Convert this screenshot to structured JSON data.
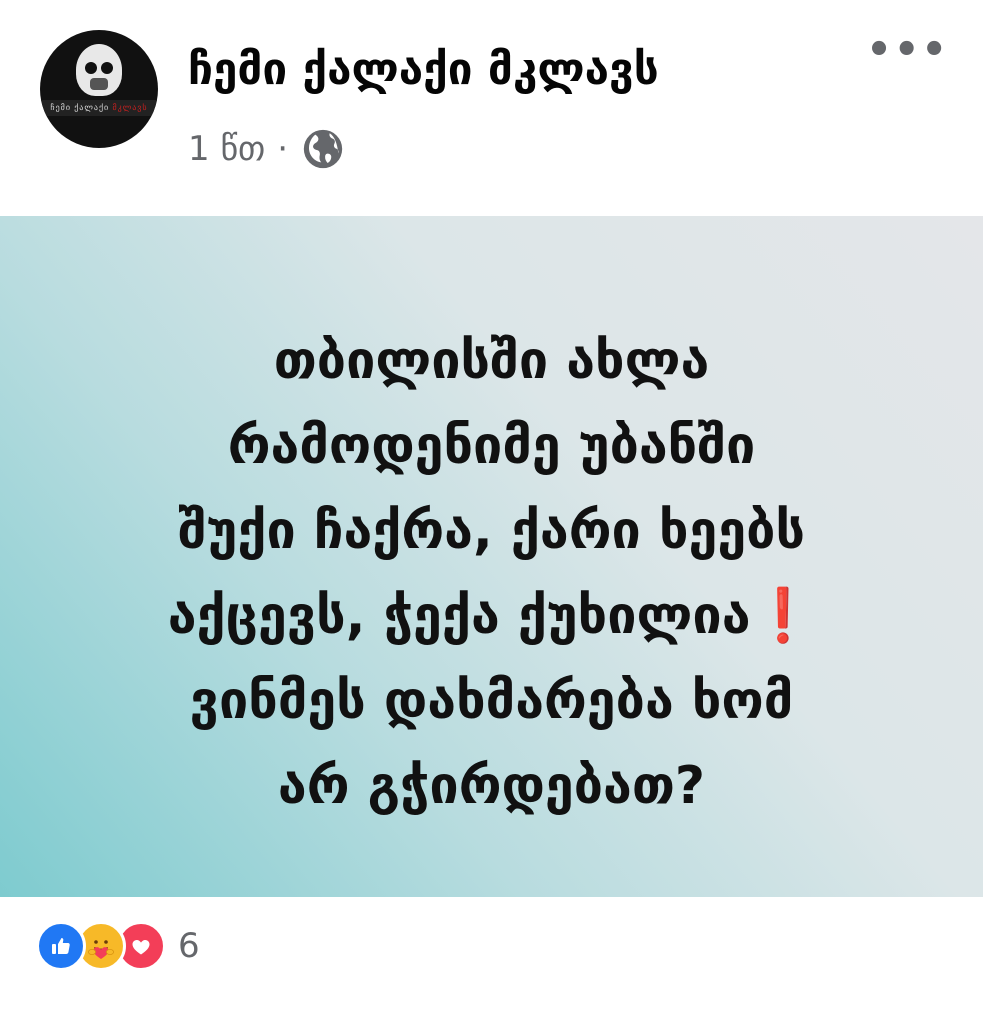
{
  "post": {
    "page_name": "ჩემი ქალაქი მკლავს",
    "time": "1 წთ",
    "separator": "·",
    "audience_icon": "globe-icon",
    "more_icon": "more-options-icon",
    "avatar": {
      "band_text_white": "ჩემი ქალაქი",
      "band_text_red": "მკლავს"
    }
  },
  "card": {
    "lines": [
      "თბილისში ახლა",
      "რამოდენიმე უბანში",
      "შუქი ჩაქრა, ქარი ხეებს",
      "აქცევს, ჭექა ქუხილია",
      "ვინმეს დახმარება ხომ",
      "არ გჭირდებათ?"
    ],
    "exclamation": "❗",
    "colors": {
      "gradient_start": "#7ecbcf",
      "gradient_end": "#e4e6e9",
      "text": "#111111"
    }
  },
  "reactions": {
    "icons": [
      "like-icon",
      "care-icon",
      "love-icon"
    ],
    "count": "6"
  },
  "colors": {
    "like": "#2078f4",
    "care": "#f7b928",
    "love": "#f33e58",
    "meta_gray": "#65676b"
  }
}
